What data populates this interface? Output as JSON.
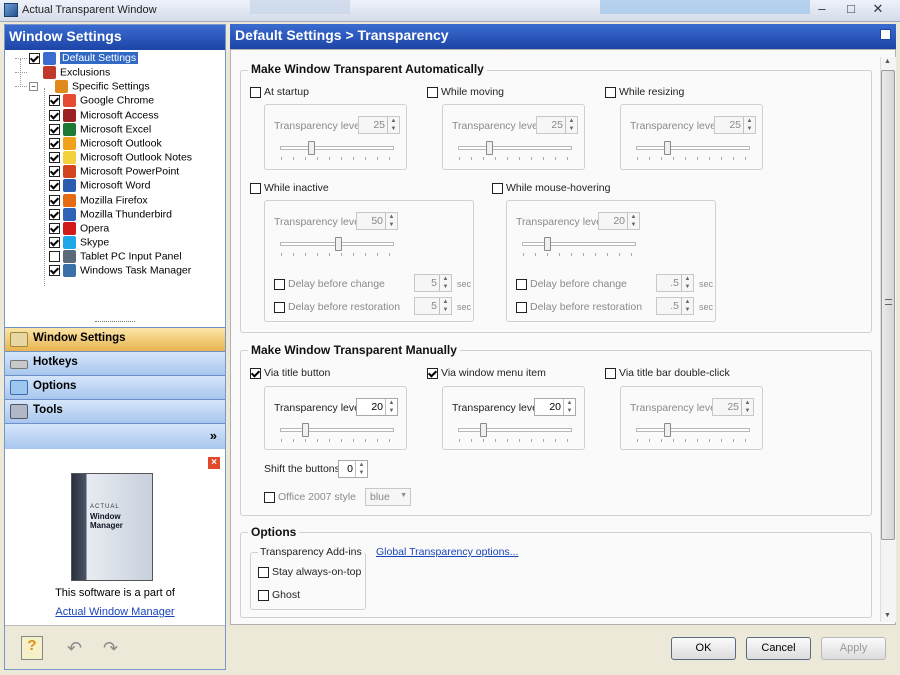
{
  "window": {
    "title": "Actual Transparent Window"
  },
  "left": {
    "header": "Window Settings",
    "tree": [
      {
        "label": "Default Settings",
        "checked": true,
        "selected": true,
        "level": 1,
        "icon": "default-settings-icon",
        "color": "#3a6cd0"
      },
      {
        "label": "Exclusions",
        "checked": null,
        "level": 1,
        "icon": "exclusions-icon",
        "color": "#c0392b"
      },
      {
        "label": "Specific Settings",
        "checked": null,
        "level": 1,
        "icon": "specific-settings-icon",
        "color": "#e08a1e",
        "expander": "−"
      },
      {
        "label": "Google Chrome",
        "checked": true,
        "level": 2,
        "icon": "chrome-icon",
        "color": "#e44b30"
      },
      {
        "label": "Microsoft Access",
        "checked": true,
        "level": 2,
        "icon": "access-icon",
        "color": "#9b2222"
      },
      {
        "label": "Microsoft Excel",
        "checked": true,
        "level": 2,
        "icon": "excel-icon",
        "color": "#1d7a36"
      },
      {
        "label": "Microsoft Outlook",
        "checked": true,
        "level": 2,
        "icon": "outlook-icon",
        "color": "#f0a21a"
      },
      {
        "label": "Microsoft Outlook Notes",
        "checked": true,
        "level": 2,
        "icon": "outlook-notes-icon",
        "color": "#f3d13b"
      },
      {
        "label": "Microsoft PowerPoint",
        "checked": true,
        "level": 2,
        "icon": "powerpoint-icon",
        "color": "#d2451e"
      },
      {
        "label": "Microsoft Word",
        "checked": true,
        "level": 2,
        "icon": "word-icon",
        "color": "#2a5db0"
      },
      {
        "label": "Mozilla Firefox",
        "checked": true,
        "level": 2,
        "icon": "firefox-icon",
        "color": "#e66a12"
      },
      {
        "label": "Mozilla Thunderbird",
        "checked": true,
        "level": 2,
        "icon": "thunderbird-icon",
        "color": "#2f63b5"
      },
      {
        "label": "Opera",
        "checked": true,
        "level": 2,
        "icon": "opera-icon",
        "color": "#d11a1a"
      },
      {
        "label": "Skype",
        "checked": true,
        "level": 2,
        "icon": "skype-icon",
        "color": "#1ea7e6"
      },
      {
        "label": "Tablet PC Input Panel",
        "checked": false,
        "level": 2,
        "icon": "tablet-input-icon",
        "color": "#5a6a7a"
      },
      {
        "label": "Windows Task Manager",
        "checked": true,
        "level": 2,
        "icon": "task-manager-icon",
        "color": "#3b6fa8"
      }
    ],
    "nav": {
      "window_settings": "Window Settings",
      "hotkeys": "Hotkeys",
      "options": "Options",
      "tools": "Tools",
      "chevron": "»"
    },
    "promo": {
      "close": "×",
      "box_brand": "ACTUAL",
      "box_title": "Window Manager",
      "line1": "This software is a part of",
      "link": "Actual Window Manager"
    }
  },
  "right": {
    "header": "Default Settings > Transparency",
    "auto": {
      "title": "Make Window Transparent Automatically",
      "at_startup": {
        "label": "At startup",
        "checked": false,
        "level_label": "Transparency level",
        "level": "25",
        "slider": 0.25
      },
      "while_moving": {
        "label": "While moving",
        "checked": false,
        "level_label": "Transparency level",
        "level": "25",
        "slider": 0.25
      },
      "while_resizing": {
        "label": "While resizing",
        "checked": false,
        "level_label": "Transparency level",
        "level": "25",
        "slider": 0.25
      },
      "while_inactive": {
        "label": "While inactive",
        "checked": false,
        "level_label": "Transparency level",
        "level": "50",
        "slider": 0.5,
        "delay_change": "Delay before change",
        "delay_change_val": "5",
        "delay_restore": "Delay before restoration",
        "delay_restore_val": "5",
        "sec": "sec"
      },
      "while_hover": {
        "label": "While mouse-hovering",
        "checked": false,
        "level_label": "Transparency level",
        "level": "20",
        "slider": 0.2,
        "delay_change": "Delay before change",
        "delay_change_val": ".5",
        "delay_restore": "Delay before restoration",
        "delay_restore_val": ".5",
        "sec": "sec"
      }
    },
    "manual": {
      "title": "Make Window Transparent Manually",
      "title_button": {
        "label": "Via title button",
        "checked": true,
        "level_label": "Transparency level",
        "level": "20",
        "slider": 0.2
      },
      "menu_item": {
        "label": "Via window menu item",
        "checked": true,
        "level_label": "Transparency level",
        "level": "20",
        "slider": 0.2
      },
      "dblclick": {
        "label": "Via title bar double-click",
        "checked": false,
        "level_label": "Transparency level",
        "level": "25",
        "slider": 0.25
      },
      "shift_label": "Shift the buttons",
      "shift_value": "0",
      "office_label": "Office 2007 style",
      "office_value": "blue"
    },
    "options": {
      "title": "Options",
      "addins_title": "Transparency Add-ins",
      "stay_on_top": "Stay always-on-top",
      "ghost": "Ghost",
      "global_link": "Global Transparency options..."
    }
  },
  "buttons": {
    "ok": "OK",
    "cancel": "Cancel",
    "apply": "Apply"
  }
}
